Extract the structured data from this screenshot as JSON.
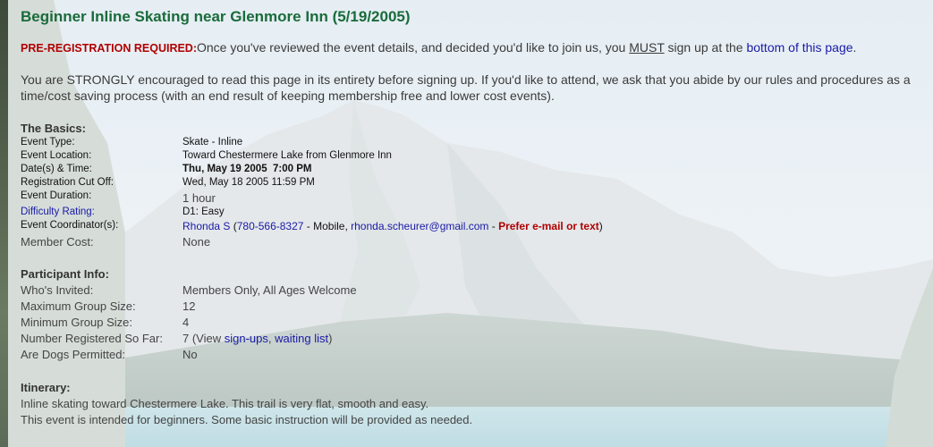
{
  "page": {
    "title": "Beginner Inline Skating near Glenmore Inn (5/19/2005)"
  },
  "intro": {
    "prereg_label": "PRE-REGISTRATION REQUIRED:",
    "prereg_text_1": "Once you've reviewed the event details, and decided you'd like to join us, you ",
    "must": "MUST",
    "prereg_text_2": " sign up at the ",
    "prereg_link": "bottom of this page",
    "prereg_text_3": ".",
    "strongly": "You are STRONGLY encouraged to read this page in its entirety before signing up. If you'd like to attend, we ask that you abide by our rules and procedures as a time/cost saving process (with an end result of keeping membership free and lower cost events)."
  },
  "basics": {
    "heading": "The Basics:",
    "event_type_label": "Event Type:",
    "event_type": "Skate - Inline",
    "event_location_label": "Event Location:",
    "event_location": "Toward Chestermere Lake from Glenmore Inn",
    "datetime_label": "Date(s) & Time:",
    "datetime": "Thu, May 19 2005  7:00 PM",
    "cutoff_label": "Registration Cut Off:",
    "cutoff": "Wed, May 18 2005 11:59 PM",
    "duration_label": "Event Duration:",
    "duration": "1 hour",
    "difficulty_label": "Difficulty Rating:",
    "difficulty": "D1: Easy",
    "coordinator_label": "Event Coordinator(s):",
    "coordinator_name": "Rhonda S",
    "coordinator_phone_open": " (",
    "coordinator_phone": "780-566-8327",
    "coordinator_mobile": " - Mobile, ",
    "coordinator_email": "rhonda.scheurer@gmail.com",
    "coordinator_dash": " - ",
    "coordinator_pref": "Prefer e-mail or text",
    "coordinator_close": ")",
    "member_cost_label": "Member Cost:",
    "member_cost": "None"
  },
  "participant": {
    "heading": "Participant Info:",
    "invited_label": "Who's Invited:",
    "invited": "Members Only, All Ages Welcome",
    "max_label": "Maximum Group Size:",
    "max": "12",
    "min_label": "Minimum Group Size:",
    "min": "4",
    "registered_label": "Number Registered So Far:",
    "registered_count": "7 (View ",
    "signups_link": "sign-ups",
    "comma": ", ",
    "waiting_link": "waiting list",
    "registered_close": ")",
    "dogs_label": "Are Dogs Permitted:",
    "dogs": "No"
  },
  "itinerary": {
    "heading": "Itinerary:",
    "line1": "Inline skating toward Chestermere Lake. This trail is very flat, smooth and easy.",
    "line2": "This event is intended for beginners. Some basic instruction will be provided as needed."
  },
  "colors": {
    "title": "#1a6b3a",
    "link": "#1a1aa6",
    "alert": "#b00000"
  }
}
